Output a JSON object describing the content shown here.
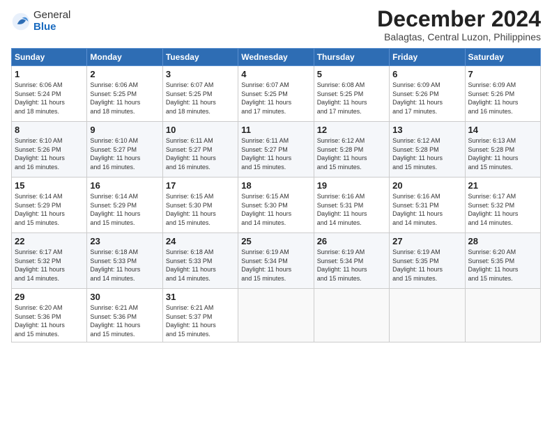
{
  "logo": {
    "general": "General",
    "blue": "Blue"
  },
  "title": "December 2024",
  "location": "Balagtas, Central Luzon, Philippines",
  "days_of_week": [
    "Sunday",
    "Monday",
    "Tuesday",
    "Wednesday",
    "Thursday",
    "Friday",
    "Saturday"
  ],
  "weeks": [
    [
      {
        "day": "1",
        "info": "Sunrise: 6:06 AM\nSunset: 5:24 PM\nDaylight: 11 hours\nand 18 minutes."
      },
      {
        "day": "2",
        "info": "Sunrise: 6:06 AM\nSunset: 5:25 PM\nDaylight: 11 hours\nand 18 minutes."
      },
      {
        "day": "3",
        "info": "Sunrise: 6:07 AM\nSunset: 5:25 PM\nDaylight: 11 hours\nand 18 minutes."
      },
      {
        "day": "4",
        "info": "Sunrise: 6:07 AM\nSunset: 5:25 PM\nDaylight: 11 hours\nand 17 minutes."
      },
      {
        "day": "5",
        "info": "Sunrise: 6:08 AM\nSunset: 5:25 PM\nDaylight: 11 hours\nand 17 minutes."
      },
      {
        "day": "6",
        "info": "Sunrise: 6:09 AM\nSunset: 5:26 PM\nDaylight: 11 hours\nand 17 minutes."
      },
      {
        "day": "7",
        "info": "Sunrise: 6:09 AM\nSunset: 5:26 PM\nDaylight: 11 hours\nand 16 minutes."
      }
    ],
    [
      {
        "day": "8",
        "info": "Sunrise: 6:10 AM\nSunset: 5:26 PM\nDaylight: 11 hours\nand 16 minutes."
      },
      {
        "day": "9",
        "info": "Sunrise: 6:10 AM\nSunset: 5:27 PM\nDaylight: 11 hours\nand 16 minutes."
      },
      {
        "day": "10",
        "info": "Sunrise: 6:11 AM\nSunset: 5:27 PM\nDaylight: 11 hours\nand 16 minutes."
      },
      {
        "day": "11",
        "info": "Sunrise: 6:11 AM\nSunset: 5:27 PM\nDaylight: 11 hours\nand 15 minutes."
      },
      {
        "day": "12",
        "info": "Sunrise: 6:12 AM\nSunset: 5:28 PM\nDaylight: 11 hours\nand 15 minutes."
      },
      {
        "day": "13",
        "info": "Sunrise: 6:12 AM\nSunset: 5:28 PM\nDaylight: 11 hours\nand 15 minutes."
      },
      {
        "day": "14",
        "info": "Sunrise: 6:13 AM\nSunset: 5:28 PM\nDaylight: 11 hours\nand 15 minutes."
      }
    ],
    [
      {
        "day": "15",
        "info": "Sunrise: 6:14 AM\nSunset: 5:29 PM\nDaylight: 11 hours\nand 15 minutes."
      },
      {
        "day": "16",
        "info": "Sunrise: 6:14 AM\nSunset: 5:29 PM\nDaylight: 11 hours\nand 15 minutes."
      },
      {
        "day": "17",
        "info": "Sunrise: 6:15 AM\nSunset: 5:30 PM\nDaylight: 11 hours\nand 15 minutes."
      },
      {
        "day": "18",
        "info": "Sunrise: 6:15 AM\nSunset: 5:30 PM\nDaylight: 11 hours\nand 14 minutes."
      },
      {
        "day": "19",
        "info": "Sunrise: 6:16 AM\nSunset: 5:31 PM\nDaylight: 11 hours\nand 14 minutes."
      },
      {
        "day": "20",
        "info": "Sunrise: 6:16 AM\nSunset: 5:31 PM\nDaylight: 11 hours\nand 14 minutes."
      },
      {
        "day": "21",
        "info": "Sunrise: 6:17 AM\nSunset: 5:32 PM\nDaylight: 11 hours\nand 14 minutes."
      }
    ],
    [
      {
        "day": "22",
        "info": "Sunrise: 6:17 AM\nSunset: 5:32 PM\nDaylight: 11 hours\nand 14 minutes."
      },
      {
        "day": "23",
        "info": "Sunrise: 6:18 AM\nSunset: 5:33 PM\nDaylight: 11 hours\nand 14 minutes."
      },
      {
        "day": "24",
        "info": "Sunrise: 6:18 AM\nSunset: 5:33 PM\nDaylight: 11 hours\nand 14 minutes."
      },
      {
        "day": "25",
        "info": "Sunrise: 6:19 AM\nSunset: 5:34 PM\nDaylight: 11 hours\nand 15 minutes."
      },
      {
        "day": "26",
        "info": "Sunrise: 6:19 AM\nSunset: 5:34 PM\nDaylight: 11 hours\nand 15 minutes."
      },
      {
        "day": "27",
        "info": "Sunrise: 6:19 AM\nSunset: 5:35 PM\nDaylight: 11 hours\nand 15 minutes."
      },
      {
        "day": "28",
        "info": "Sunrise: 6:20 AM\nSunset: 5:35 PM\nDaylight: 11 hours\nand 15 minutes."
      }
    ],
    [
      {
        "day": "29",
        "info": "Sunrise: 6:20 AM\nSunset: 5:36 PM\nDaylight: 11 hours\nand 15 minutes."
      },
      {
        "day": "30",
        "info": "Sunrise: 6:21 AM\nSunset: 5:36 PM\nDaylight: 11 hours\nand 15 minutes."
      },
      {
        "day": "31",
        "info": "Sunrise: 6:21 AM\nSunset: 5:37 PM\nDaylight: 11 hours\nand 15 minutes."
      },
      null,
      null,
      null,
      null
    ]
  ]
}
